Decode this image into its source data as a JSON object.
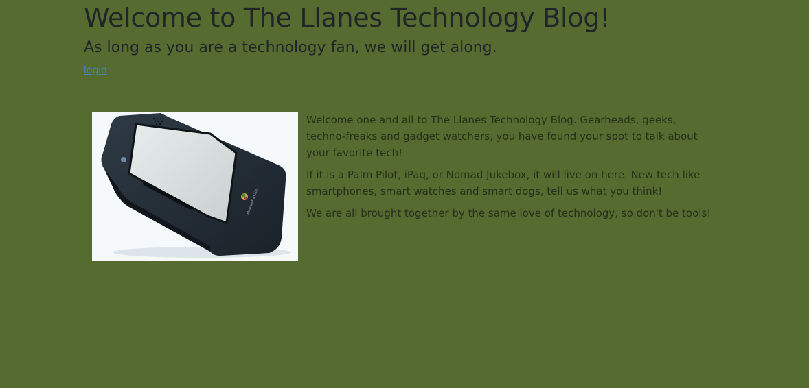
{
  "header": {
    "title": "Welcome to The Llanes Technology Blog!",
    "subtitle": "As long as you are a technology fan, we will get along.",
    "login_label": "login"
  },
  "main": {
    "image_alt": "Apple Newton MessagePad handheld device",
    "device_label": "MessagePad 200",
    "paragraphs": [
      "Welcome one and all to The Llanes Technology Blog. Gearheads, geeks, techno-freaks and gadget watchers, you have found your spot to talk about your favorite tech!",
      "If it is a Palm Pilot, iPaq, or Nomad Jukebox, it will live on here. New tech like smartphones, smart watches and smart dogs, tell us what you think!",
      "We are all brought together by the same love of technology, so don't be tools!"
    ]
  },
  "colors": {
    "background": "#556b2f",
    "text": "#212529",
    "link": "#4a7fc0"
  }
}
